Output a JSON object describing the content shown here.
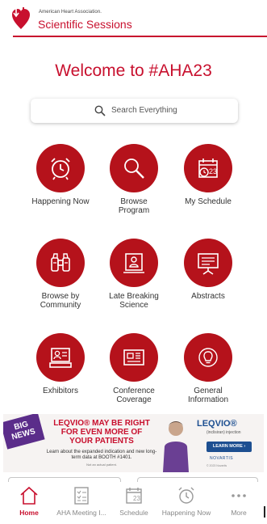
{
  "header": {
    "org_name": "American Heart Association.",
    "event_name": "Scientific Sessions",
    "brand_color": "#c8102e"
  },
  "welcome": "Welcome to #AHA23",
  "search": {
    "placeholder": "Search Everything",
    "icon": "search-icon"
  },
  "tiles": [
    {
      "label": "Happening Now",
      "icon": "alarm-clock-icon"
    },
    {
      "label": "Browse Program",
      "icon": "magnifier-icon"
    },
    {
      "label": "My Schedule",
      "icon": "calendar-clock-icon",
      "day": "23"
    },
    {
      "label": "Browse by Community",
      "icon": "binoculars-icon"
    },
    {
      "label": "Late Breaking Science",
      "icon": "presenter-board-icon"
    },
    {
      "label": "Abstracts",
      "icon": "easel-chart-icon"
    },
    {
      "label": "Exhibitors",
      "icon": "exhibitor-booth-icon"
    },
    {
      "label": "Conference Coverage",
      "icon": "newspaper-icon"
    },
    {
      "label": "General Information",
      "icon": "lightbulb-icon"
    }
  ],
  "ad": {
    "badge_line1": "BIG",
    "badge_line2": "NEWS",
    "headline_line1": "LEQVIO® MAY BE RIGHT",
    "headline_line2": "FOR EVEN MORE OF",
    "headline_line3": "YOUR PATIENTS",
    "body": "Learn about the expanded indication and new long-term data at BOOTH #1401.",
    "footnote": "Not an actual patient.",
    "product": "LEQVIO®",
    "product_sub": "(inclisiran) injection",
    "cta": "LEARN MORE ›",
    "sponsor": "NOVARTIS",
    "copyright": "© 2023 Novartis",
    "accent_color": "#5b2d8a"
  },
  "tabbar": {
    "items": [
      {
        "label": "Home",
        "icon": "home-icon",
        "active": true
      },
      {
        "label": "AHA Meeting I...",
        "icon": "checklist-icon",
        "active": false
      },
      {
        "label": "Schedule",
        "icon": "calendar-icon",
        "active": false,
        "day": "23"
      },
      {
        "label": "Happening Now",
        "icon": "alarm-clock-icon",
        "active": false
      },
      {
        "label": "More",
        "icon": "more-dots-icon",
        "active": false
      }
    ]
  }
}
